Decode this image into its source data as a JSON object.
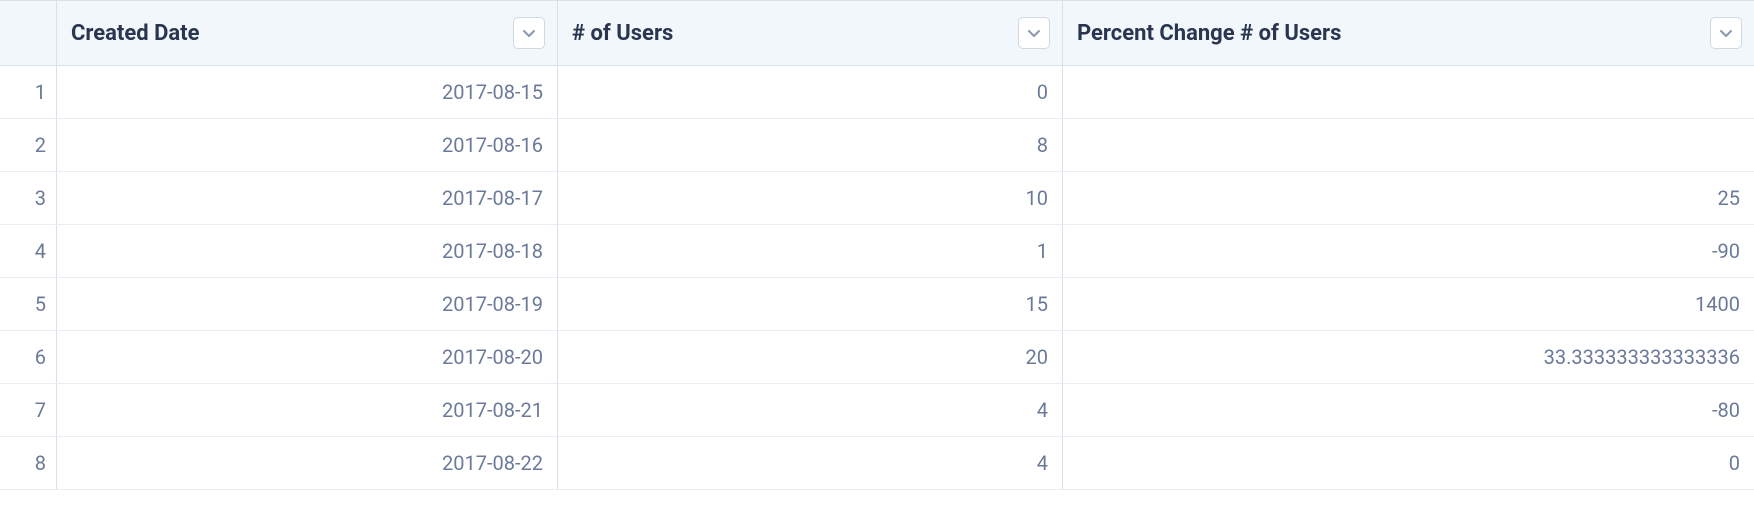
{
  "columns": {
    "col0": "Created Date",
    "col1": "# of Users",
    "col2": "Percent Change # of Users"
  },
  "rows": [
    {
      "num": "1",
      "created_date": "2017-08-15",
      "users": "0",
      "pct": ""
    },
    {
      "num": "2",
      "created_date": "2017-08-16",
      "users": "8",
      "pct": ""
    },
    {
      "num": "3",
      "created_date": "2017-08-17",
      "users": "10",
      "pct": "25"
    },
    {
      "num": "4",
      "created_date": "2017-08-18",
      "users": "1",
      "pct": "-90"
    },
    {
      "num": "5",
      "created_date": "2017-08-19",
      "users": "15",
      "pct": "1400"
    },
    {
      "num": "6",
      "created_date": "2017-08-20",
      "users": "20",
      "pct": "33.333333333333336"
    },
    {
      "num": "7",
      "created_date": "2017-08-21",
      "users": "4",
      "pct": "-80"
    },
    {
      "num": "8",
      "created_date": "2017-08-22",
      "users": "4",
      "pct": "0"
    }
  ]
}
